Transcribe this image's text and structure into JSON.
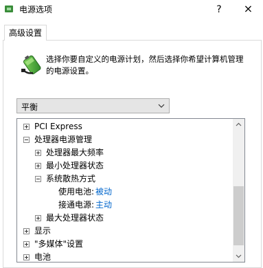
{
  "window": {
    "title": "电源选项",
    "help_label": "?",
    "close_label": "×"
  },
  "tabs": [
    {
      "label": "高级设置",
      "selected": true
    }
  ],
  "description": {
    "line1": "选择你要自定义的电源计划，然后选择你希望计算机管理",
    "line2": "的电源设置。"
  },
  "plan_dropdown": {
    "value": "平衡"
  },
  "tree": {
    "items": [
      {
        "label": "PCI Express",
        "expander": "plus"
      },
      {
        "label": "处理器电源管理",
        "expander": "minus"
      },
      {
        "label": "处理器最大频率",
        "expander": "plus"
      },
      {
        "label": "最小处理器状态",
        "expander": "plus"
      },
      {
        "label": "系统散热方式",
        "expander": "minus"
      },
      {
        "label": "使用电池:",
        "value": "被动"
      },
      {
        "label": "接通电源:",
        "value": "主动"
      },
      {
        "label": "最大处理器状态",
        "expander": "plus"
      },
      {
        "label": "显示",
        "expander": "plus"
      },
      {
        "label": "\"多媒体\"设置",
        "expander": "plus"
      },
      {
        "label": "电池",
        "expander": "plus"
      }
    ]
  },
  "colors": {
    "link": "#0066cc",
    "border": "#828790"
  },
  "icons": [
    "battery-power-icon",
    "chevron-down-icon",
    "plus-expander-icon",
    "minus-expander-icon",
    "scroll-up-arrow-icon",
    "scroll-down-arrow-icon"
  ]
}
